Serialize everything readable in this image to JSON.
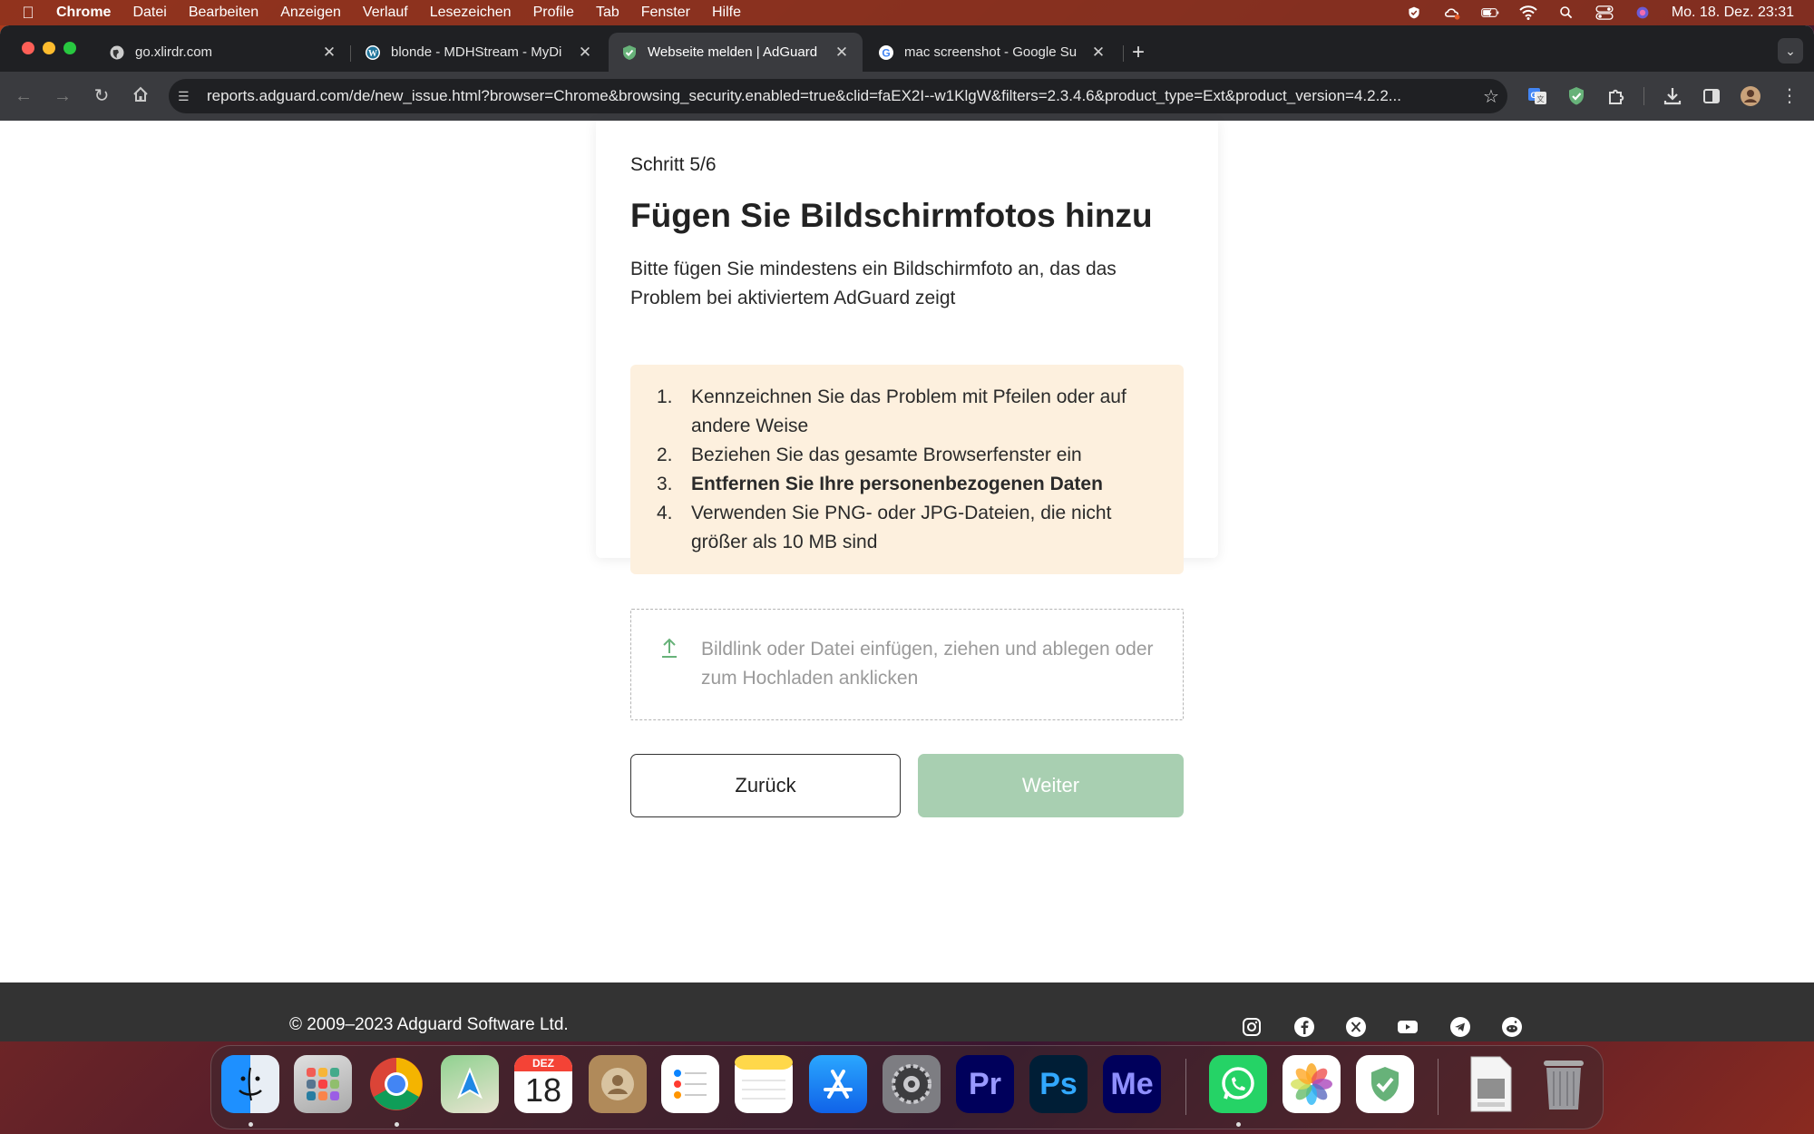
{
  "menubar": {
    "app": "Chrome",
    "items": [
      "Datei",
      "Bearbeiten",
      "Anzeigen",
      "Verlauf",
      "Lesezeichen",
      "Profile",
      "Tab",
      "Fenster",
      "Hilfe"
    ],
    "clock": "Mo. 18. Dez.  23:31"
  },
  "tabs": [
    {
      "title": "go.xlirdr.com",
      "icon": "globe-icon"
    },
    {
      "title": "blonde - MDHStream - MyDi",
      "icon": "wordpress-icon"
    },
    {
      "title": "Webseite melden | AdGuard",
      "icon": "adguard-shield-icon",
      "active": true
    },
    {
      "title": "mac screenshot - Google Su",
      "icon": "google-icon"
    }
  ],
  "address_bar": {
    "url": "reports.adguard.com/de/new_issue.html?browser=Chrome&browsing_security.enabled=true&clid=faEX2I--w1KlgW&filters=2.3.4.6&product_type=Ext&product_version=4.2.2..."
  },
  "form": {
    "step": "Schritt 5/6",
    "heading": "Fügen Sie Bildschirmfotos hinzu",
    "subtitle": "Bitte fügen Sie mindestens ein Bildschirmfoto an, das das Problem bei aktiviertem AdGuard zeigt",
    "hints": [
      {
        "num": "1.",
        "text": "Kennzeichnen Sie das Problem mit Pfeilen oder auf andere Weise"
      },
      {
        "num": "2.",
        "text": "Beziehen Sie das gesamte Browserfenster ein"
      },
      {
        "num": "3.",
        "text": "Entfernen Sie Ihre personenbezogenen Daten"
      },
      {
        "num": "4.",
        "text": "Verwenden Sie PNG- oder JPG-Dateien, die nicht größer als 10 MB sind"
      }
    ],
    "dropzone_text": "Bildlink oder Datei einfügen, ziehen und ablegen oder zum Hochladen anklicken",
    "back_label": "Zurück",
    "next_label": "Weiter"
  },
  "footer": {
    "copyright": "© 2009–2023 Adguard Software Ltd.",
    "social": [
      "instagram-icon",
      "facebook-icon",
      "x-icon",
      "youtube-icon",
      "telegram-icon",
      "reddit-icon"
    ]
  },
  "dock": {
    "calendar_month": "DEZ",
    "calendar_day": "18",
    "apps": [
      "Finder",
      "Launchpad",
      "Chrome",
      "Maps",
      "Kalender",
      "Kontakte",
      "Erinnerungen",
      "Notizen",
      "App Store",
      "Systemeinstellungen",
      "Premiere Pro",
      "Photoshop",
      "Media Encoder",
      "WhatsApp",
      "Fotos",
      "AdGuard",
      "Vorschau",
      "Papierkorb"
    ],
    "labels": {
      "pr": "Pr",
      "ps": "Ps",
      "me": "Me"
    }
  },
  "colors": {
    "accent_green": "#67b279",
    "next_button_disabled": "#a8cfb1",
    "hint_background": "#fdf0de",
    "footer_background": "#333333"
  }
}
